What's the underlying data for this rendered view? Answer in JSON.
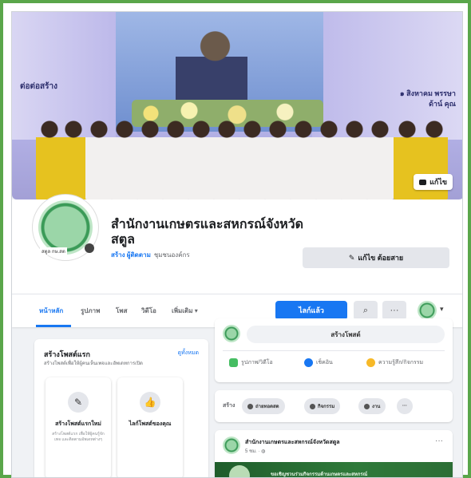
{
  "cover": {
    "text_left": "ต่อต่อสร้าง",
    "text_right_1": "๑ สิงหาคม พรรษา",
    "text_right_2": "ด้าน์ คุณ",
    "edit_label": "แก้ไข"
  },
  "page": {
    "name": "สำนักงานเกษตรและสหกรณ์จังหวัดสตูล",
    "avatar_tag": "สตูล กษ.สต",
    "sub_link": "สร้าง ผู้ติดตาม",
    "sub_text": "ชุมชนองค์กร",
    "edit_button": "แก้ไข ต้อยสาย"
  },
  "nav": {
    "tabs": [
      "หน้าหลัก",
      "รูปภาพ",
      "โพส",
      "วิดีโอ",
      "เพิ่มเติม ▾"
    ],
    "like_button": "ไลก์แล้ว",
    "search_icon": "⌕",
    "more_icon": "···",
    "caret": "▾"
  },
  "left_card": {
    "title": "สร้างโพสต์แรก",
    "subtitle": "สร้างโพสต์เพื่อให้ผู้คนเห็นเพจและอัพเดทการเปิด",
    "see_all": "ดูทั้งหมด",
    "items": [
      {
        "icon": "edit-icon",
        "glyph": "✎",
        "label": "สร้างโพสต์แรกใหม่",
        "desc": "สร้างโพสต์แรก เพื่อให้ผู้คนรู้จักเพจ และติดตามอัพเดทต่างๆ"
      },
      {
        "icon": "like-icon",
        "glyph": "👍",
        "label": "ไลก์โพสต์ของคุณ",
        "desc": ""
      }
    ]
  },
  "composer": {
    "placeholder": "สร้างโพสต์",
    "actions": [
      "รูปภาพ/วิดีโอ",
      "เช็คอิน",
      "ความรู้สึก/กิจกรรม"
    ]
  },
  "create_row": {
    "label": "สร้าง",
    "chips": [
      "ถ่ายทอดสด",
      "กิจกรรม",
      "งาน"
    ],
    "more": "···"
  },
  "post": {
    "author": "สำนักงานเกษตรและสหกรณ์จังหวัดสตูล",
    "time": "5 ชม. · ◍",
    "more": "···",
    "media_caption": "ขอเชิญชวนร่วมกิจกรรมด้านเกษตรและสหกรณ์"
  },
  "colors": {
    "frame": "#5aa64a",
    "accent": "#1877f2"
  }
}
